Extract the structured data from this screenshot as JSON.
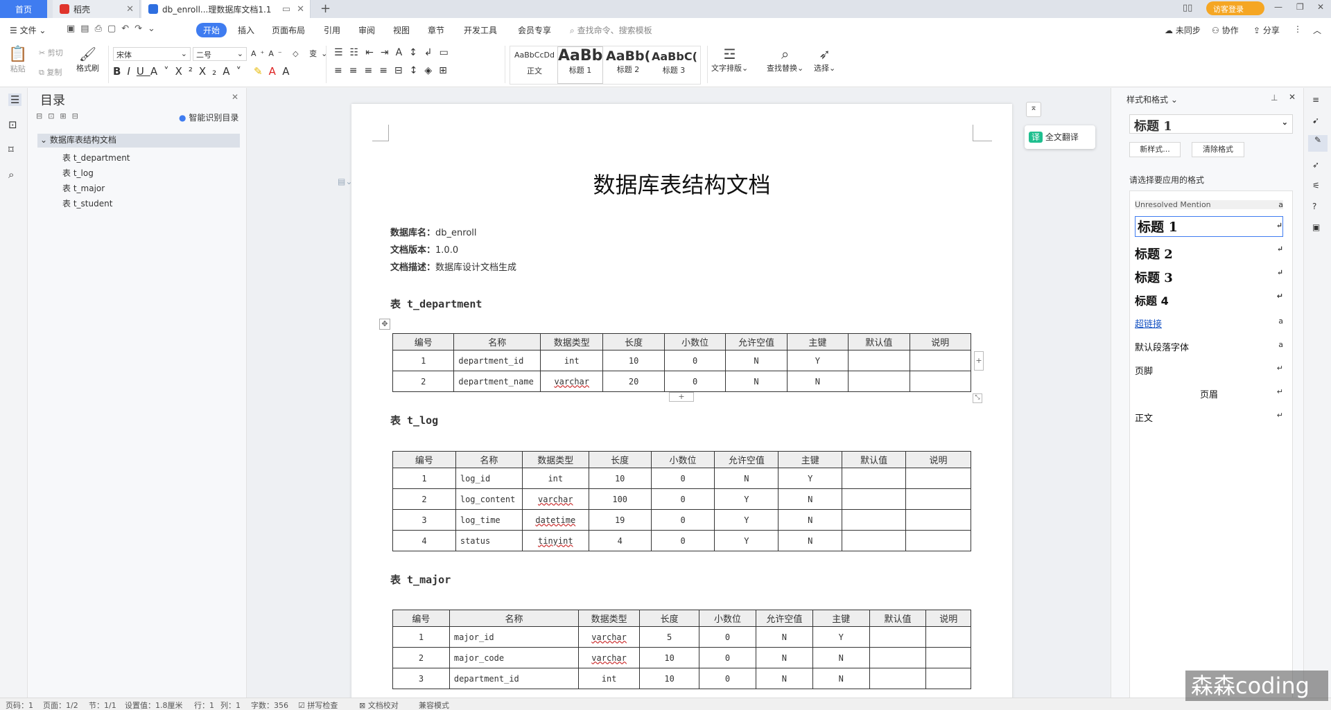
{
  "tabs": {
    "home": "首页",
    "daoke": "稻壳",
    "doc": "db_enroll...理数据库文档1.1"
  },
  "titlebar": {
    "login": "访客登录"
  },
  "menu": {
    "file": "文件",
    "start": "开始",
    "insert": "插入",
    "layout": "页面布局",
    "reference": "引用",
    "review": "审阅",
    "view": "视图",
    "chapter": "章节",
    "devtools": "开发工具",
    "member": "会员专享",
    "search_placeholder": "查找命令、搜索模板",
    "sync": "未同步",
    "collab": "协作",
    "share": "分享"
  },
  "ribbon": {
    "paste": "粘贴",
    "cut": "剪切",
    "copy": "复制",
    "format_painter": "格式刷",
    "font": "宋体",
    "size": "二号",
    "styles": [
      {
        "preview": "AaBbCcDd",
        "label": "正文"
      },
      {
        "preview": "AaBb",
        "label": "标题 1"
      },
      {
        "preview": "AaBb(",
        "label": "标题 2"
      },
      {
        "preview": "AaBbC(",
        "label": "标题 3"
      }
    ],
    "text_layout": "文字排版",
    "find_replace": "查找替换",
    "select": "选择"
  },
  "toc": {
    "title": "目录",
    "smart": "智能识别目录",
    "root": "数据库表结构文档",
    "items": [
      "表 t_department",
      "表 t_log",
      "表 t_major",
      "表 t_student"
    ]
  },
  "translate": "全文翻译",
  "document": {
    "title": "数据库表结构文档",
    "meta": [
      {
        "k": "数据库名：",
        "v": "db_enroll"
      },
      {
        "k": "文档版本：",
        "v": "1.0.0"
      },
      {
        "k": "文档描述：",
        "v": "数据库设计文档生成"
      }
    ],
    "headers": [
      "编号",
      "名称",
      "数据类型",
      "长度",
      "小数位",
      "允许空值",
      "主键",
      "默认值",
      "说明"
    ],
    "tables": [
      {
        "heading": "表 t_department",
        "rows": [
          [
            "1",
            "department_id",
            "int",
            "10",
            "0",
            "N",
            "Y",
            "",
            ""
          ],
          [
            "2",
            "department_name",
            "varchar",
            "20",
            "0",
            "N",
            "N",
            "",
            ""
          ]
        ]
      },
      {
        "heading": "表 t_log",
        "rows": [
          [
            "1",
            "log_id",
            "int",
            "10",
            "0",
            "N",
            "Y",
            "",
            ""
          ],
          [
            "2",
            "log_content",
            "varchar",
            "100",
            "0",
            "Y",
            "N",
            "",
            ""
          ],
          [
            "3",
            "log_time",
            "datetime",
            "19",
            "0",
            "Y",
            "N",
            "",
            ""
          ],
          [
            "4",
            "status",
            "tinyint",
            "4",
            "0",
            "Y",
            "N",
            "",
            ""
          ]
        ]
      },
      {
        "heading": "表 t_major",
        "rows": [
          [
            "1",
            "major_id",
            "varchar",
            "5",
            "0",
            "N",
            "Y",
            "",
            ""
          ],
          [
            "2",
            "major_code",
            "varchar",
            "10",
            "0",
            "N",
            "N",
            "",
            ""
          ],
          [
            "3",
            "department_id",
            "int",
            "10",
            "0",
            "N",
            "N",
            "",
            ""
          ]
        ]
      }
    ]
  },
  "styles_panel": {
    "title": "样式和格式",
    "current": "标题  1",
    "new_style": "新样式...",
    "clear_format": "清除格式",
    "prompt": "请选择要应用的格式",
    "items": [
      {
        "label": "Unresolved Mention",
        "mark": "a"
      },
      {
        "label": "标题  1",
        "mark": "↵"
      },
      {
        "label": "标题  2",
        "mark": "↵"
      },
      {
        "label": "标题  3",
        "mark": "↵"
      },
      {
        "label": "标题  4",
        "mark": "↵"
      },
      {
        "label": "超链接",
        "mark": "a"
      },
      {
        "label": "默认段落字体",
        "mark": "a"
      },
      {
        "label": "页脚",
        "mark": "↵"
      },
      {
        "label": "页眉",
        "mark": "↵"
      },
      {
        "label": "正文",
        "mark": "↵"
      }
    ]
  },
  "status": {
    "page": "页码：1",
    "pages": "页面：1/2",
    "section": "节：1/1",
    "setting": "设置值：1.8厘米",
    "row": "行：1",
    "col": "列：1",
    "words": "字数：356",
    "spell": "拼写检查",
    "proof": "文档校对",
    "compat": "兼容模式"
  },
  "watermark": "森森coding",
  "colors": {
    "accent": "#3f7cf0",
    "brand_red": "#e0342b",
    "login_orange": "#f5a623"
  }
}
